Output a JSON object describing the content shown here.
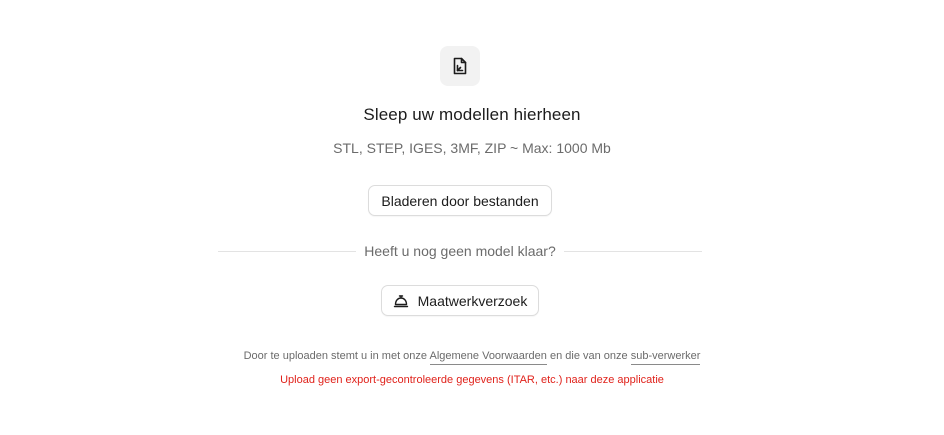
{
  "upload": {
    "icon": "file-chart-icon",
    "title": "Sleep uw modellen hierheen",
    "formats": "STL, STEP, IGES, 3MF, ZIP ~ Max: 1000 Mb",
    "browse_label": "Bladeren door bestanden"
  },
  "divider": {
    "text": "Heeft u nog geen model klaar?"
  },
  "custom_request": {
    "icon": "service-bell-icon",
    "label": "Maatwerkverzoek"
  },
  "terms": {
    "prefix": "Door te uploaden stemt u in met onze",
    "terms_link": "Algemene Voorwaarden",
    "middle": "en die van onze",
    "processor_link": "sub-verwerker"
  },
  "warning": {
    "text": "Upload geen export-gecontroleerde gegevens (ITAR, etc.) naar deze applicatie",
    "color": "#e0221b"
  }
}
